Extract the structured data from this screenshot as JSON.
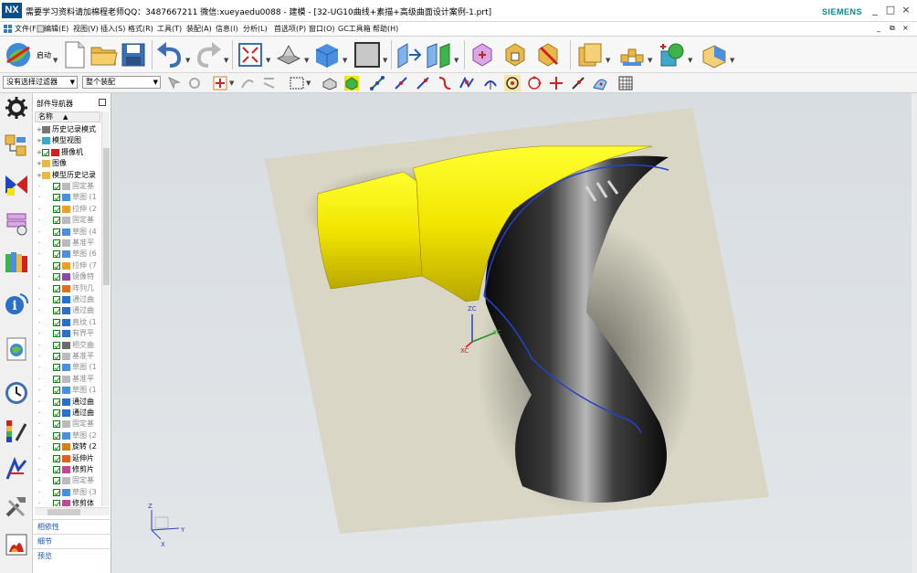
{
  "window": {
    "logo": "NX",
    "title": "需要学习资料请加棉程老师QQ：3487667211  微信:xueyaedu0088 - 建模 - [32-UG10曲线+素描+高级曲面设计案例-1.prt]",
    "brand": "SIEMENS",
    "controls": [
      "_",
      "□",
      "×"
    ]
  },
  "menu": {
    "items": [
      "文件(F)",
      "编辑(E)",
      "视图(V)",
      "插入(S)",
      "格式(R)",
      "工具(T)",
      "装配(A)",
      "信息(I)",
      "分析(L)",
      "首选项(P)",
      "窗口(O)",
      "GC工具箱",
      "帮助(H)"
    ],
    "doc_controls": [
      "_",
      "⧉",
      "×"
    ]
  },
  "ribbon": {
    "start_label": "启动"
  },
  "toolbar2": {
    "filter_value": "没有选择过滤器",
    "scope_value": "整个装配"
  },
  "navigator": {
    "title": "部件导航器",
    "column_header": "名称",
    "rows": [
      {
        "label": "历史记录模式",
        "level": 0,
        "type": "node",
        "dim": false
      },
      {
        "label": "模型视图",
        "level": 0,
        "type": "view",
        "dim": false
      },
      {
        "label": "摄像机",
        "level": 0,
        "type": "camera",
        "dim": false
      },
      {
        "label": "图像",
        "level": 0,
        "type": "folder",
        "dim": false
      },
      {
        "label": "模型历史记录",
        "level": 0,
        "type": "folder",
        "dim": false
      },
      {
        "label": "固定基",
        "level": 1,
        "type": "datum",
        "dim": true
      },
      {
        "label": "草图 (1",
        "level": 1,
        "type": "sketch",
        "dim": true
      },
      {
        "label": "拉伸 (2",
        "level": 1,
        "type": "extrude",
        "dim": true
      },
      {
        "label": "固定基",
        "level": 1,
        "type": "datum",
        "dim": true
      },
      {
        "label": "草图 (4",
        "level": 1,
        "type": "sketch",
        "dim": true
      },
      {
        "label": "基准平",
        "level": 1,
        "type": "datum",
        "dim": true
      },
      {
        "label": "草图 (6",
        "level": 1,
        "type": "sketch",
        "dim": true
      },
      {
        "label": "拉伸 (7",
        "level": 1,
        "type": "extrude",
        "dim": true
      },
      {
        "label": "镜像特",
        "level": 1,
        "type": "mirror",
        "dim": true
      },
      {
        "label": "阵列几",
        "level": 1,
        "type": "pattern",
        "dim": true
      },
      {
        "label": "通过曲",
        "level": 1,
        "type": "surface",
        "dim": true
      },
      {
        "label": "通过曲",
        "level": 1,
        "type": "surface",
        "dim": true
      },
      {
        "label": "直纹 (1",
        "level": 1,
        "type": "surface",
        "dim": true
      },
      {
        "label": "有界平",
        "level": 1,
        "type": "surface",
        "dim": true
      },
      {
        "label": "相交曲",
        "level": 1,
        "type": "curve",
        "dim": true
      },
      {
        "label": "基准平",
        "level": 1,
        "type": "datum",
        "dim": true
      },
      {
        "label": "草图 (1",
        "level": 1,
        "type": "sketch",
        "dim": true
      },
      {
        "label": "基准平",
        "level": 1,
        "type": "datum",
        "dim": true
      },
      {
        "label": "草图 (1",
        "level": 1,
        "type": "sketch",
        "dim": true
      },
      {
        "label": "通过曲",
        "level": 1,
        "type": "surface",
        "dim": false
      },
      {
        "label": "通过曲",
        "level": 1,
        "type": "surface",
        "dim": false
      },
      {
        "label": "固定基",
        "level": 1,
        "type": "datum",
        "dim": true
      },
      {
        "label": "草图 (2",
        "level": 1,
        "type": "sketch",
        "dim": true
      },
      {
        "label": "旋转 (2",
        "level": 1,
        "type": "revolve",
        "dim": false
      },
      {
        "label": "延伸片",
        "level": 1,
        "type": "extend",
        "dim": false
      },
      {
        "label": "修剪片",
        "level": 1,
        "type": "trim",
        "dim": false
      },
      {
        "label": "固定基",
        "level": 1,
        "type": "datum",
        "dim": true
      },
      {
        "label": "草图 (3",
        "level": 1,
        "type": "sketch",
        "dim": true
      },
      {
        "label": "修剪体",
        "level": 1,
        "type": "trim",
        "dim": false
      }
    ],
    "panels": [
      "相依性",
      "细节",
      "预览"
    ]
  },
  "viewport": {
    "csys_labels": {
      "zc": "ZC",
      "yc": "YC",
      "xc": "XC"
    },
    "abs_labels": {
      "z": "Z",
      "y": "Y",
      "x": "X"
    }
  },
  "colors": {
    "yellow_body": "#f2e600",
    "sketch_paper": "#d9d6c5",
    "curve_blue": "#2343c8",
    "nav_link": "#1a56b0"
  }
}
